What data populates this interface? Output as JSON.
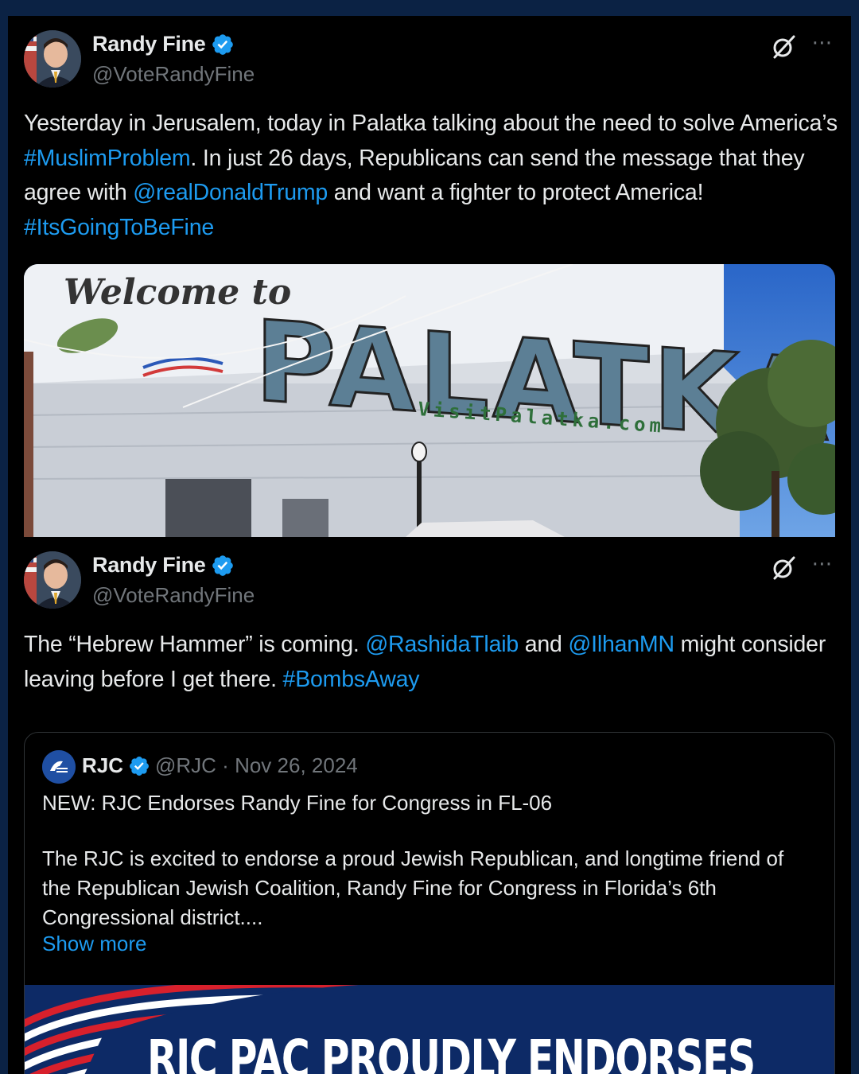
{
  "tweets": [
    {
      "author": {
        "display_name": "Randy Fine",
        "handle": "@VoteRandyFine"
      },
      "text_segments": [
        {
          "text": "Yesterday in Jerusalem, today in Palatka talking about the need to solve America’s ",
          "link": false
        },
        {
          "text": "#MuslimProblem",
          "link": true
        },
        {
          "text": ".   In just 26 days, Republicans can send the message that they agree with ",
          "link": false
        },
        {
          "text": "@realDonaldTrump",
          "link": true
        },
        {
          "text": " and want a fighter to protect America!  ",
          "link": false
        },
        {
          "text": "#ItsGoingToBeFine",
          "link": true
        }
      ],
      "photo": {
        "sign_welcome": "Welcome to",
        "sign_town": "PALATKA",
        "sign_url": "VisitPalatka.com"
      }
    },
    {
      "author": {
        "display_name": "Randy Fine",
        "handle": "@VoteRandyFine"
      },
      "text_segments": [
        {
          "text": "The “Hebrew Hammer” is coming.   ",
          "link": false
        },
        {
          "text": "@RashidaTlaib",
          "link": true
        },
        {
          "text": " and ",
          "link": false
        },
        {
          "text": "@IlhanMN",
          "link": true
        },
        {
          "text": " might consider leaving before I get there.  ",
          "link": false
        },
        {
          "text": "#BombsAway",
          "link": true
        }
      ],
      "quote": {
        "display_name": "RJC",
        "handle": "@RJC",
        "date": "Nov 26, 2024",
        "meta": "@RJC · Nov 26, 2024",
        "headline": "NEW: RJC Endorses Randy Fine for Congress in FL-06",
        "body": "The RJC is excited to endorse a proud Jewish Republican, and longtime friend of the Republican Jewish Coalition, Randy Fine for Congress in Florida’s 6th Congressional district....",
        "show_more": "Show more",
        "banner_text": "RJC PAC PROUDLY ENDORSES"
      }
    }
  ],
  "icons": {
    "verified": "verified-badge-icon",
    "grok": "grok-slash-icon",
    "more": "more-options-icon"
  },
  "colors": {
    "background_frame": "#0b2244",
    "card_background": "#000000",
    "link_blue": "#1d9bf0",
    "secondary_text": "#71767b",
    "primary_text": "#e7e9ea",
    "banner_navy": "#0d2a66",
    "flag_red": "#d8202c"
  }
}
